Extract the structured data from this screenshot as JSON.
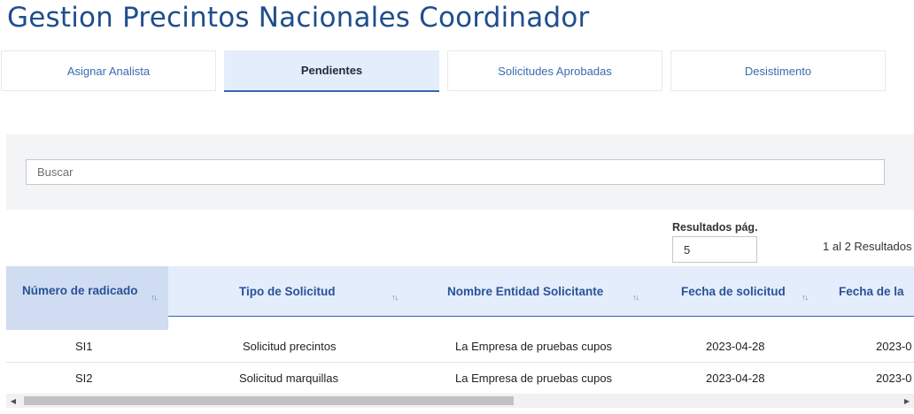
{
  "page": {
    "title": "Gestion Precintos Nacionales Coordinador"
  },
  "tabs": [
    {
      "label": "Asignar Analista",
      "active": false
    },
    {
      "label": "Pendientes",
      "active": true
    },
    {
      "label": "Solicitudes Aprobadas",
      "active": false
    },
    {
      "label": "Desistimento",
      "active": false
    }
  ],
  "search": {
    "placeholder": "Buscar",
    "value": ""
  },
  "pagination": {
    "page_size_label": "Resultados pág.",
    "page_size_value": "5",
    "results_text": "1 al 2 Resultados"
  },
  "table": {
    "columns": [
      {
        "label": "Número de radicado",
        "sorted": true
      },
      {
        "label": "Tipo de Solicitud",
        "sorted": false
      },
      {
        "label": "Nombre Entidad Solicitante",
        "sorted": false
      },
      {
        "label": "Fecha de solicitud",
        "sorted": false
      },
      {
        "label": "Fecha de la",
        "sorted": false
      }
    ],
    "rows": [
      {
        "radicado": "SI1",
        "tipo": "Solicitud precintos",
        "entidad": "La Empresa de pruebas cupos",
        "fecha": "2023-04-28",
        "fecha2": "2023-0"
      },
      {
        "radicado": "SI2",
        "tipo": "Solicitud marquillas",
        "entidad": "La Empresa de pruebas cupos",
        "fecha": "2023-04-28",
        "fecha2": "2023-0"
      }
    ],
    "sort_glyph": "↑↓"
  },
  "colors": {
    "primary": "#1f4e8c",
    "tab_active_bg": "#e3edfb",
    "header_bg": "#e3edfb"
  },
  "scrollbar": {
    "left_arrow": "◀",
    "right_arrow": "▶"
  }
}
